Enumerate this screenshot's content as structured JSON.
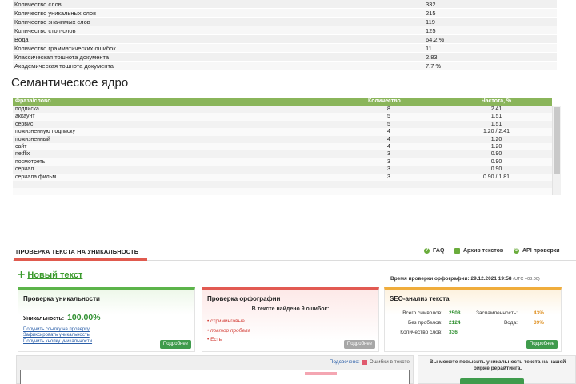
{
  "stats": [
    {
      "label": "Количество слов",
      "value": "332"
    },
    {
      "label": "Количество уникальных слов",
      "value": "215"
    },
    {
      "label": "Количество значимых слов",
      "value": "119"
    },
    {
      "label": "Количество стоп-слов",
      "value": "125"
    },
    {
      "label": "Вода",
      "value": "64.2 %"
    },
    {
      "label": "Количество грамматических ошибок",
      "value": "11"
    },
    {
      "label": "Классическая тошнота документа",
      "value": "2.83"
    },
    {
      "label": "Академическая тошнота документа",
      "value": "7.7 %"
    }
  ],
  "semantic": {
    "title": "Семантическое ядро",
    "headers": {
      "phrase": "Фраза/слово",
      "count": "Количество",
      "freq": "Частота, %"
    },
    "rows": [
      {
        "phrase": "подписка",
        "count": "8",
        "freq": "2.41"
      },
      {
        "phrase": "аккаунт",
        "count": "5",
        "freq": "1.51"
      },
      {
        "phrase": "сервис",
        "count": "5",
        "freq": "1.51"
      },
      {
        "phrase": "пожизненную подписку",
        "count": "4",
        "freq": "1.20 / 2.41"
      },
      {
        "phrase": "пожизненный",
        "count": "4",
        "freq": "1.20"
      },
      {
        "phrase": "сайт",
        "count": "4",
        "freq": "1.20"
      },
      {
        "phrase": "netflix",
        "count": "3",
        "freq": "0.90"
      },
      {
        "phrase": "посмотреть",
        "count": "3",
        "freq": "0.90"
      },
      {
        "phrase": "сериал",
        "count": "3",
        "freq": "0.90"
      },
      {
        "phrase": "сериала фильм",
        "count": "3",
        "freq": "0.90 / 1.81"
      },
      {
        "phrase": "",
        "count": "",
        "freq": ""
      },
      {
        "phrase": "",
        "count": "",
        "freq": ""
      }
    ]
  },
  "app": {
    "title": "ПРОВЕРКА ТЕКСТА НА УНИКАЛЬНОСТЬ",
    "links": {
      "faq": "FAQ",
      "archive": "Архив текстов",
      "api": "API проверки"
    },
    "new_text": "Новый текст",
    "check_time_label": "Время проверки орфографии: 29.12.2021 19:58",
    "check_time_tz": "(UTC +03:00)"
  },
  "uniqueness": {
    "title": "Проверка уникальности",
    "label": "Уникальность:",
    "value": "100.00%",
    "links": [
      "Получить ссылку на проверку",
      "Зафиксировать уникальность",
      "Получить кнопку уникальности"
    ],
    "button": "Подробнее"
  },
  "spelling": {
    "title": "Проверка орфографии",
    "found": "В тексте найдено 9 ошибок:",
    "errors": [
      "стриминговые",
      "повтор пробела",
      "Есть"
    ],
    "button": "Подробнее"
  },
  "seo": {
    "title": "SEO-анализ текста",
    "rows": [
      {
        "k": "Всего символов:",
        "v": "2508",
        "k2": "Заспамленность:",
        "v2": "43%"
      },
      {
        "k": "Без пробелов:",
        "v": "2124",
        "k2": "Вода:",
        "v2": "39%"
      },
      {
        "k": "Количество слов:",
        "v": "336",
        "k2": "",
        "v2": ""
      }
    ],
    "button": "Подробнее"
  },
  "editor": {
    "status_label": "Подсвечено:",
    "errors_label": "Ошибки в тексте"
  },
  "boost": {
    "text": "Вы можете повысить уникальность текста на нашей бирже рерайтинга."
  },
  "colors": {
    "green": "#5cb44a",
    "red": "#e25a52",
    "orange": "#f0ad3c",
    "header_green": "#8ab55a"
  }
}
